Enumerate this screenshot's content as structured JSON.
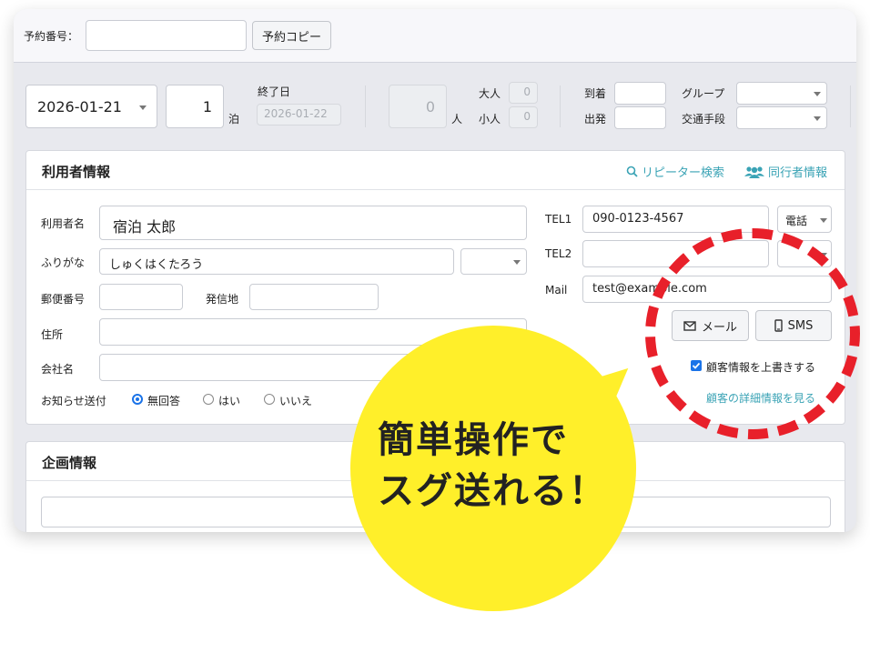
{
  "header": {
    "reservation_no_label": "予約番号：",
    "reservation_no_value": "",
    "copy_button": "予約コピー"
  },
  "stay": {
    "checkin_date": "2026-01-21",
    "nights": "1",
    "nights_unit": "泊",
    "end_date_label": "終了日",
    "end_date": "2026-01-22",
    "guests_total": "0",
    "guests_unit": "人",
    "adult_label": "大人",
    "adult_count": "0",
    "child_label": "小人",
    "child_count": "0",
    "arrival_label": "到着",
    "departure_label": "出発",
    "group_label": "グループ",
    "transport_label": "交通手段"
  },
  "user_info": {
    "title": "利用者情報",
    "repeater_search": "リピーター検索",
    "companion_info": "同行者情報",
    "name_label": "利用者名",
    "name_value": "宿泊 太郎",
    "kana_label": "ふりがな",
    "kana_value": "しゅくはくたろう",
    "postal_label": "郵便番号",
    "origin_label": "発信地",
    "address_label": "住所",
    "company_label": "会社名",
    "notify_label": "お知らせ送付",
    "notify_options": [
      "無回答",
      "はい",
      "いいえ"
    ],
    "notify_selected": "無回答",
    "tel1_label": "TEL1",
    "tel1_value": "090-0123-4567",
    "tel1_type": "電話",
    "tel2_label": "TEL2",
    "mail_label": "Mail",
    "mail_value": "test@example.com",
    "mail_button": "メール",
    "sms_button": "SMS",
    "overwrite_label": "顧客情報を上書きする",
    "overwrite_checked": true,
    "detail_link": "顧客の詳細情報を見る"
  },
  "plan_info": {
    "title": "企画情報"
  },
  "callout": {
    "line1": "簡単操作で",
    "line2": "スグ送れる！"
  },
  "colors": {
    "accent_link": "#3aa3b5",
    "highlight_red": "#e8202a",
    "bubble_yellow": "#ffef2a",
    "checkbox_blue": "#1a73e8"
  }
}
